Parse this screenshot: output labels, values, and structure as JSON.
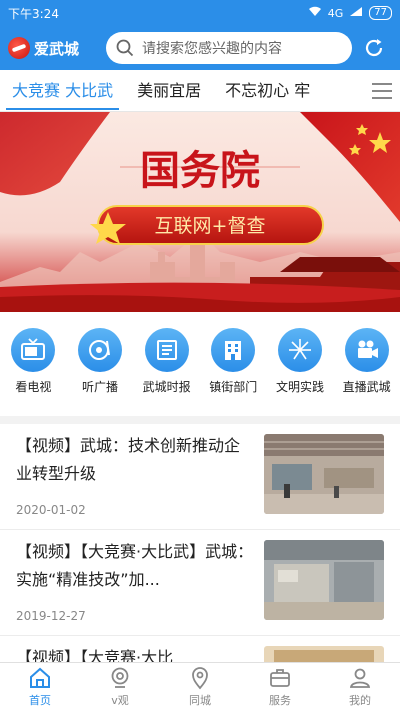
{
  "status_bar": {
    "time": "下午3:24",
    "signal": "4G",
    "battery": "77"
  },
  "header": {
    "logo_text": "爱武城",
    "search_placeholder": "请搜索您感兴趣的内容",
    "brand_color": "#2b8ee8"
  },
  "tabs": [
    {
      "label": "大竞赛  大比武",
      "active": true
    },
    {
      "label": "美丽宜居",
      "active": false
    },
    {
      "label": "不忘初心  牢",
      "active": false
    }
  ],
  "banner": {
    "title": "国务院",
    "subtitle": "互联网+督查"
  },
  "grid": [
    {
      "label": "看电视",
      "icon": "tv-icon"
    },
    {
      "label": "听广播",
      "icon": "radio-icon"
    },
    {
      "label": "武城时报",
      "icon": "newspaper-icon"
    },
    {
      "label": "镇街部门",
      "icon": "building-icon"
    },
    {
      "label": "文明实践",
      "icon": "firework-icon"
    },
    {
      "label": "直播武城",
      "icon": "video-camera-icon"
    }
  ],
  "news": [
    {
      "title": "【视频】武城：技术创新推动企业转型升级",
      "date": "2020-01-02"
    },
    {
      "title": "【视频】【大竞赛·大比武】武城：实施“精准技改”加...",
      "date": "2019-12-27"
    },
    {
      "title": "【视频】【大竞赛·大比",
      "date": ""
    }
  ],
  "bottom_nav": [
    {
      "label": "首页",
      "icon": "home-icon",
      "active": true
    },
    {
      "label": "v观",
      "icon": "camera-eye-icon",
      "active": false
    },
    {
      "label": "同城",
      "icon": "location-pin-icon",
      "active": false
    },
    {
      "label": "服务",
      "icon": "briefcase-icon",
      "active": false
    },
    {
      "label": "我的",
      "icon": "user-icon",
      "active": false
    }
  ]
}
